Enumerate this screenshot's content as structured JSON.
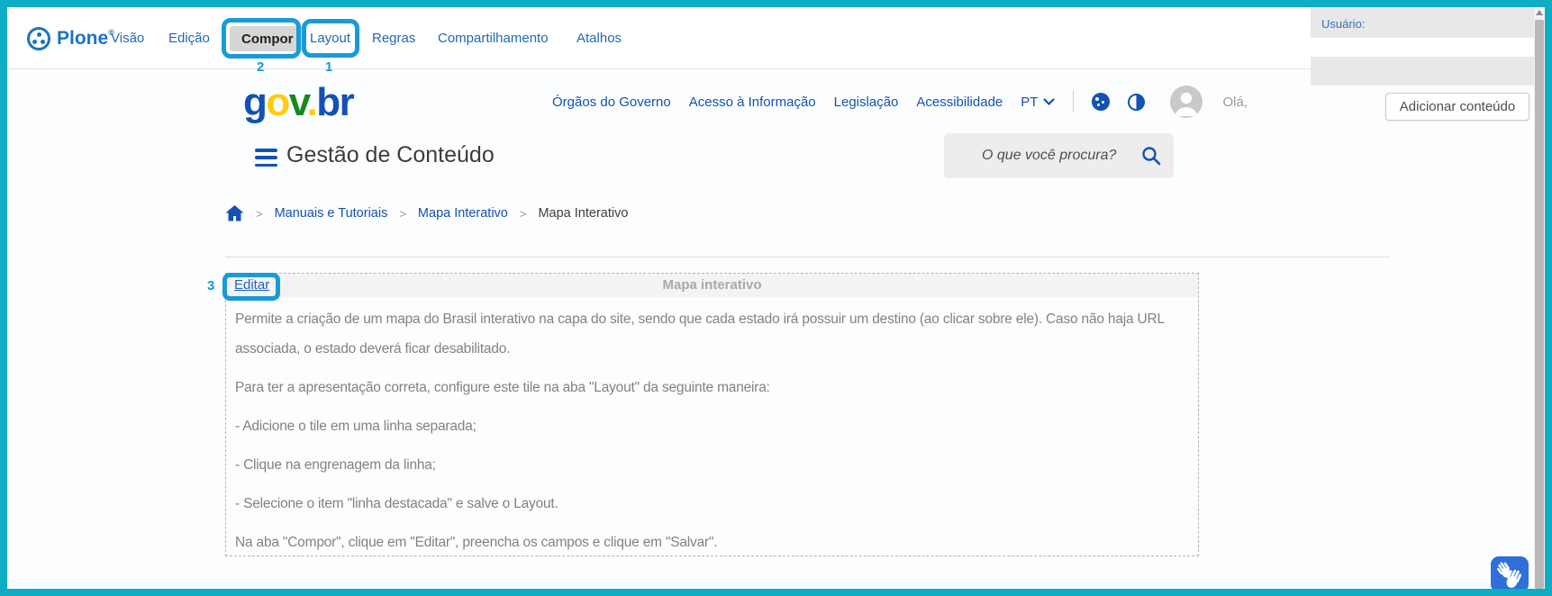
{
  "toolbar": {
    "logo": "Plone",
    "logo_reg": "®",
    "items": [
      {
        "label": "Visão"
      },
      {
        "label": "Edição"
      },
      {
        "label": "Compor",
        "selected": true
      },
      {
        "label": "Layout"
      },
      {
        "label": "Regras"
      },
      {
        "label": "Compartilhamento"
      },
      {
        "label": "Atalhos"
      }
    ],
    "user_label": "Usuário:"
  },
  "annotations": {
    "layout_step": "1",
    "compor_step": "2",
    "editar_step": "3",
    "highlight_color": "#189BD8"
  },
  "header": {
    "logo_parts": [
      {
        "text": "g",
        "color": "#1351B4"
      },
      {
        "text": "o",
        "color": "#FFCD07"
      },
      {
        "text": "v",
        "color": "#168821"
      },
      {
        "text": ".",
        "color": "#FFCD07"
      },
      {
        "text": "br",
        "color": "#1351B4"
      }
    ],
    "nav": [
      {
        "label": "Órgãos do Governo"
      },
      {
        "label": "Acesso à Informação"
      },
      {
        "label": "Legislação"
      },
      {
        "label": "Acessibilidade"
      }
    ],
    "language": "PT",
    "greeting": "Olá,",
    "add_content_button": "Adicionar conteúdo"
  },
  "titlebar": {
    "title": "Gestão de Conteúdo",
    "search_placeholder": "O que você procura?"
  },
  "breadcrumb": {
    "separator": ">",
    "links": [
      {
        "label": "Manuais e Tutoriais"
      },
      {
        "label": "Mapa Interativo"
      }
    ],
    "current": "Mapa Interativo"
  },
  "tile": {
    "edit_link": "Editar",
    "title": "Mapa interativo",
    "paragraphs": [
      "Permite a criação de um mapa do Brasil interativo na capa do site, sendo que cada estado irá possuir um destino (ao clicar sobre ele). Caso não haja URL associada, o estado deverá ficar desabilitado.",
      "Para ter a apresentação correta, configure este tile na aba \"Layout\" da seguinte maneira:",
      "- Adicione o tile em uma linha separada;",
      "- Clique na engrenagem da linha;",
      "- Selecione o item \"linha destacada\" e salve o Layout.",
      "Na aba \"Compor\", clique em \"Editar\", preencha os campos e clique em \"Salvar\"."
    ]
  },
  "colors": {
    "frame_teal": "#0FADC4",
    "govbr_blue": "#1351B4",
    "govbr_yellow": "#FFCD07",
    "govbr_green": "#168821",
    "plone_blue": "#1C74C4",
    "annotation_cyan": "#189BD8",
    "vlibras_blue": "#2E6FD8"
  },
  "icons": {
    "plone-logo-icon": "circle-with-three-dots",
    "hamburger-icon": "three-bars",
    "search-icon": "magnifier",
    "home-icon": "house",
    "chevron-down-icon": "chevron-down",
    "cookie-icon": "cookie-dots",
    "contrast-icon": "half-filled-circle",
    "avatar-icon": "person-silhouette",
    "vlibras-icon": "sign-language-hands",
    "scrollbar-up-icon": "triangle-up"
  }
}
